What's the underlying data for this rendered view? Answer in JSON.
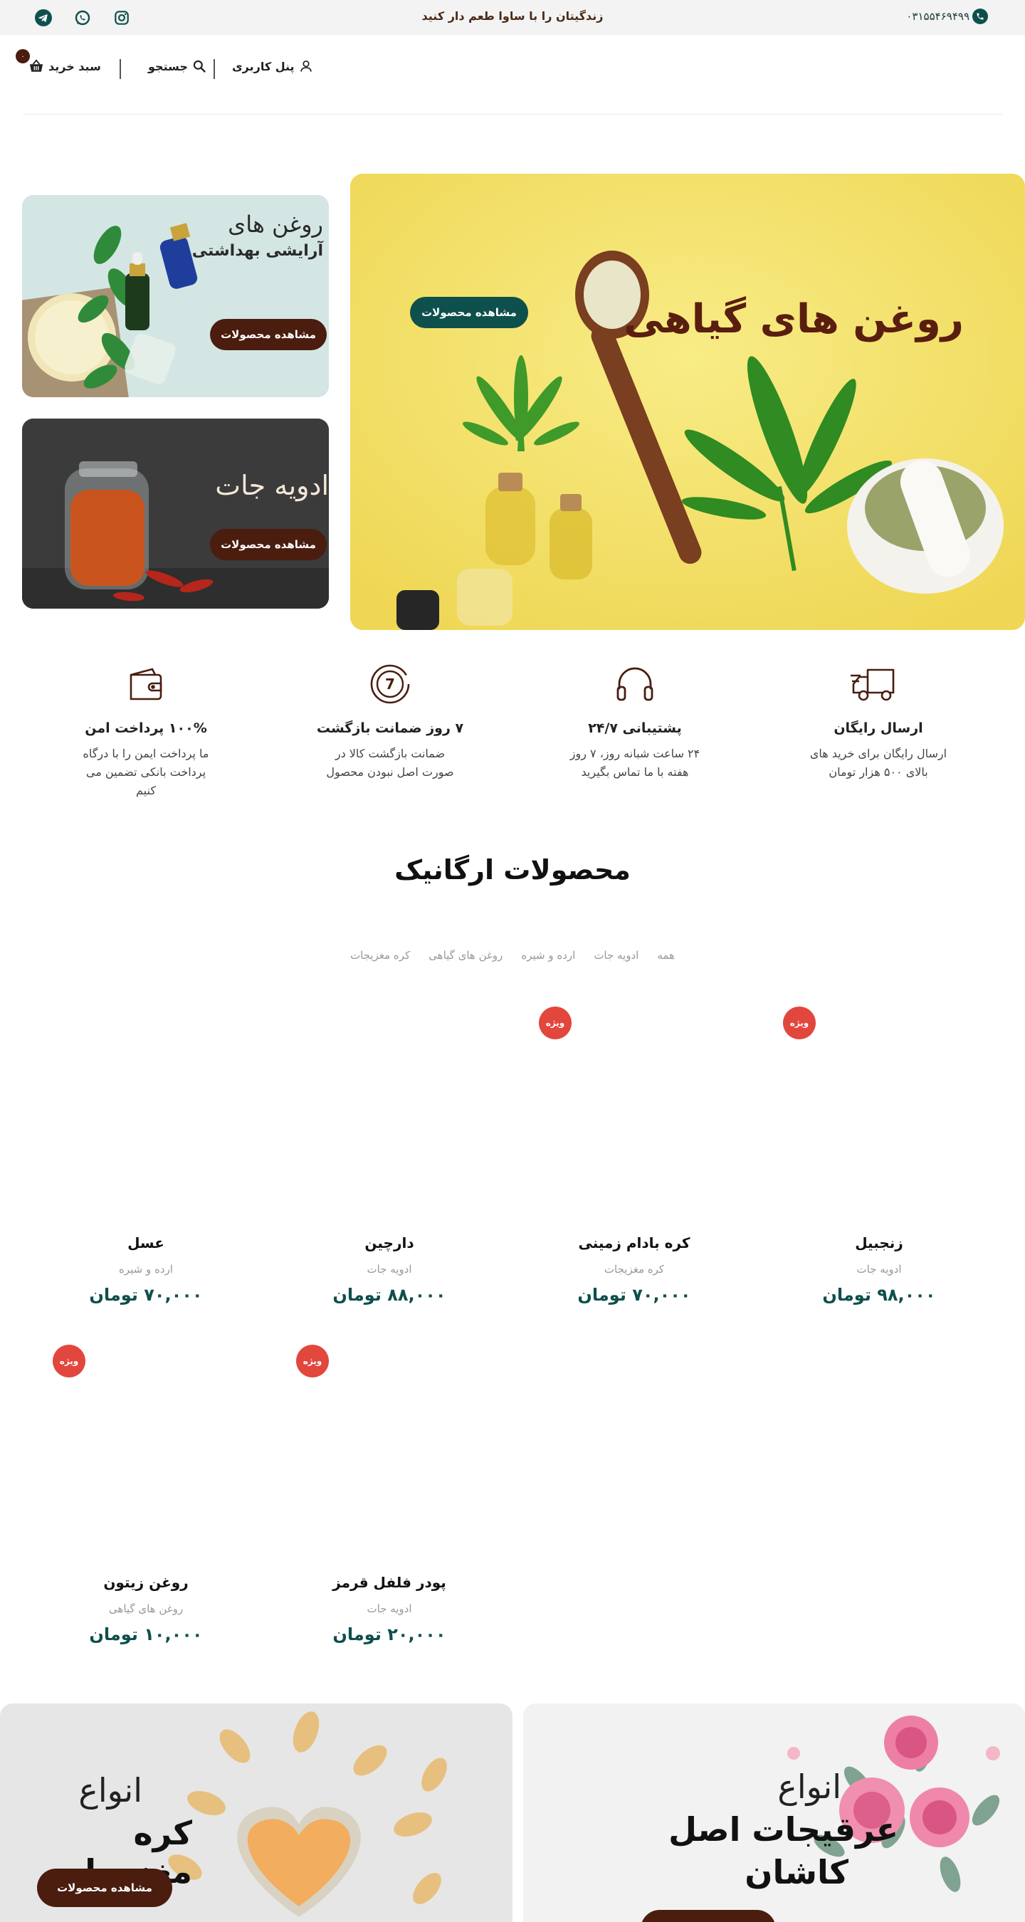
{
  "topbar": {
    "phone": "۰۳۱۵۵۴۶۹۴۹۹",
    "tagline": "زندگیتان را با ساوا طعم دار کنید",
    "socials": [
      "instagram-icon",
      "whatsapp-icon",
      "telegram-icon"
    ]
  },
  "header": {
    "user_panel": "پنل کاربری",
    "search": "جستجو",
    "cart": "سبد خرید",
    "cart_count": "۰"
  },
  "hero": {
    "main_title": "روغن های گیاهی",
    "main_button": "مشاهده محصولات",
    "card1_title": "روغن های",
    "card1_subtitle": "آرایشی بهداشتی",
    "card1_button": "مشاهده محصولات",
    "card2_title": "ادویه جات",
    "card2_button": "مشاهده محصولات"
  },
  "features": [
    {
      "title": "ارسال رایگان",
      "desc": "ارسال رایگان برای خرید های بالای ۵۰۰ هزار تومان",
      "icon": "truck-icon"
    },
    {
      "title": "پشتیبانی ۲۴/۷",
      "desc": "۲۴ ساعت شبانه روز، ۷ روز هفته با ما تماس بگیرید",
      "icon": "headphones-icon"
    },
    {
      "title": "۷ روز ضمانت بازگشت",
      "desc": "ضمانت بازگشت کالا در صورت اصل نبودن محصول",
      "icon": "seven-day-return-icon"
    },
    {
      "title": "۱۰۰% پرداخت امن",
      "desc": "ما پرداخت ایمن را با درگاه پرداخت بانکی تضمین می کنیم",
      "icon": "wallet-icon"
    }
  ],
  "section": {
    "title": "محصولات ارگانیک",
    "tabs": [
      "همه",
      "ادویه جات",
      "ارده و شیره",
      "روغن های گیاهی",
      "کره مغزیجات"
    ]
  },
  "badge_label": "ویژه",
  "products": [
    {
      "name": "زنجبیل",
      "category": "ادویه جات",
      "price": "۹۸,۰۰۰ تومان",
      "special": true
    },
    {
      "name": "کره بادام زمینی",
      "category": "کره مغزیجات",
      "price": "۷۰,۰۰۰ تومان",
      "special": true
    },
    {
      "name": "دارچین",
      "category": "ادویه جات",
      "price": "۸۸,۰۰۰ تومان",
      "special": false
    },
    {
      "name": "عسل",
      "category": "ارده و شیره",
      "price": "۷۰,۰۰۰ تومان",
      "special": false
    },
    {
      "name": "پودر فلفل قرمز",
      "category": "ادویه جات",
      "price": "۲۰,۰۰۰ تومان",
      "special": true
    },
    {
      "name": "روغن زیتون",
      "category": "روغن های گیاهی",
      "price": "۱۰,۰۰۰ تومان",
      "special": true
    }
  ],
  "banners": {
    "left_line1": "انواع",
    "left_line2": "کره مغزیجات",
    "left_button": "مشاهده محصولات",
    "right_line1": "انواع",
    "right_line2": "عرقیجات اصل",
    "right_line3": "کاشان"
  },
  "colors": {
    "brand_teal": "#0e504c",
    "brand_brown": "#4a1d0e",
    "badge_red": "#e2473d",
    "hero_yellow": "#f5e46e"
  }
}
